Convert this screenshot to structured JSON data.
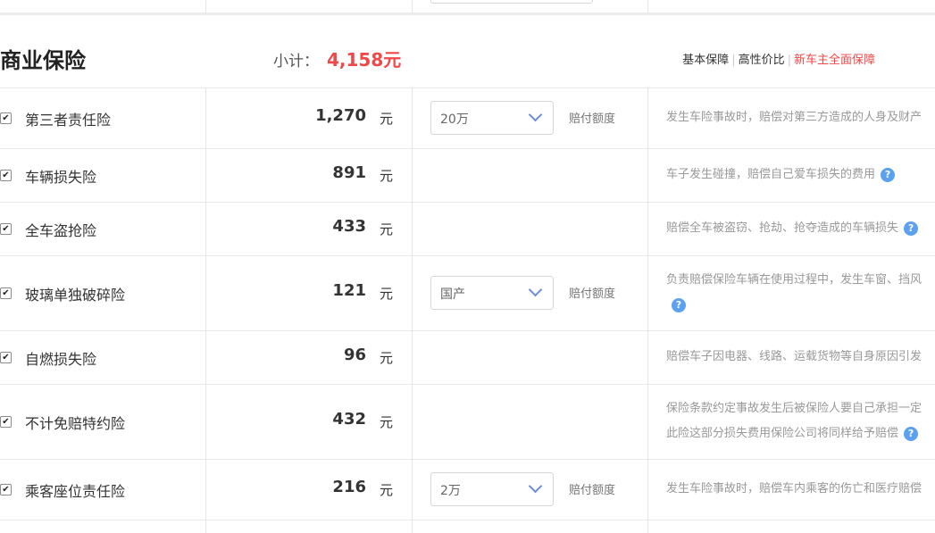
{
  "section": {
    "title": "商业保险",
    "subtotal_label": "小计：",
    "subtotal_value": "4,158元"
  },
  "plans": [
    {
      "label": "基本保障"
    },
    {
      "label": "高性价比"
    },
    {
      "label": "新车主全面保障"
    }
  ],
  "colors": {
    "accent_red": "#f04848",
    "help_blue": "#5ca0f0",
    "divider": "#e5e5e5"
  },
  "icons": {
    "checkbox": "checkbox-checked-icon",
    "help": "question-circle-icon",
    "dropdown": "chevron-down-icon"
  },
  "items": [
    {
      "checked": true,
      "name": "第三者责任险",
      "price": "1,270",
      "unit": "元",
      "select": "20万",
      "coverage_label": "赔付额度",
      "desc": [
        "发生车险事故时，赔偿对第三方造成的人身及财产"
      ],
      "help": false
    },
    {
      "checked": true,
      "name": "车辆损失险",
      "price": "891",
      "unit": "元",
      "desc": [
        "车子发生碰撞，赔偿自己爱车损失的费用"
      ],
      "help": true
    },
    {
      "checked": true,
      "name": "全车盗抢险",
      "price": "433",
      "unit": "元",
      "desc": [
        "赔偿全车被盗窃、抢劫、抢夺造成的车辆损失"
      ],
      "help": true
    },
    {
      "checked": true,
      "name": "玻璃单独破碎险",
      "price": "121",
      "unit": "元",
      "select": "国产",
      "coverage_label": "赔付额度",
      "desc": [
        "负责赔偿保险车辆在使用过程中，发生车窗、挡风"
      ],
      "help": true
    },
    {
      "checked": true,
      "name": "自燃损失险",
      "price": "96",
      "unit": "元",
      "desc": [
        "赔偿车子因电器、线路、运载货物等自身原因引发"
      ],
      "help": false
    },
    {
      "checked": true,
      "name": "不计免赔特约险",
      "price": "432",
      "unit": "元",
      "desc": [
        "保险条款约定事故发生后被保险人要自己承担一定",
        "此险这部分损失费用保险公司将同样给予赔偿"
      ],
      "help": true
    },
    {
      "checked": true,
      "name": "乘客座位责任险",
      "price": "216",
      "unit": "元",
      "select": "2万",
      "coverage_label": "赔付额度",
      "desc": [
        "发生车险事故时，赔偿车内乘客的伤亡和医疗赔偿"
      ],
      "help": false
    }
  ]
}
